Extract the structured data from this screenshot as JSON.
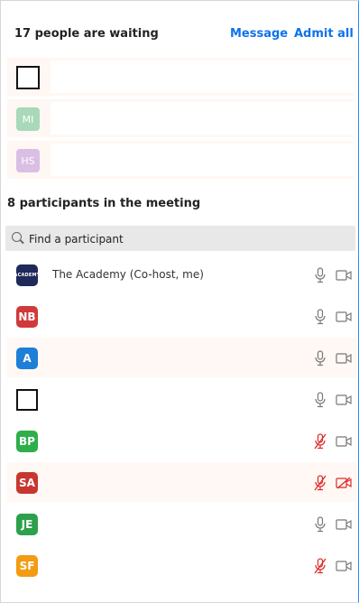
{
  "waiting": {
    "title": "17 people are waiting",
    "message_label": "Message",
    "admit_all_label": "Admit all",
    "rows": [
      {
        "initials": "",
        "color": "#ffffff"
      },
      {
        "initials": "MI",
        "color": "#a8d9b8"
      },
      {
        "initials": "HS",
        "color": "#d9bfe3"
      }
    ]
  },
  "meeting": {
    "title": "8 participants in the meeting",
    "search_placeholder": "Find a participant",
    "participants": [
      {
        "name": "The Academy (Co-host, me)",
        "avatar": "ACADEMY",
        "color": "#1f2a5a",
        "mic": "on",
        "camera": "off"
      },
      {
        "name": "",
        "avatar": "NB",
        "color": "#d03a3a",
        "mic": "on",
        "camera": "off"
      },
      {
        "name": "",
        "avatar": "A",
        "color": "#1e7fd6",
        "mic": "on",
        "camera": "off"
      },
      {
        "name": "",
        "avatar": "",
        "color": "#ffffff",
        "mic": "on",
        "camera": "off"
      },
      {
        "name": "",
        "avatar": "BP",
        "color": "#2fae4a",
        "mic": "muted",
        "camera": "off"
      },
      {
        "name": "",
        "avatar": "SA",
        "color": "#c8372f",
        "mic": "muted",
        "camera": "disabled"
      },
      {
        "name": "",
        "avatar": "JE",
        "color": "#2ca04a",
        "mic": "on",
        "camera": "off"
      },
      {
        "name": "",
        "avatar": "SF",
        "color": "#f39c12",
        "mic": "muted",
        "camera": "off"
      }
    ]
  }
}
